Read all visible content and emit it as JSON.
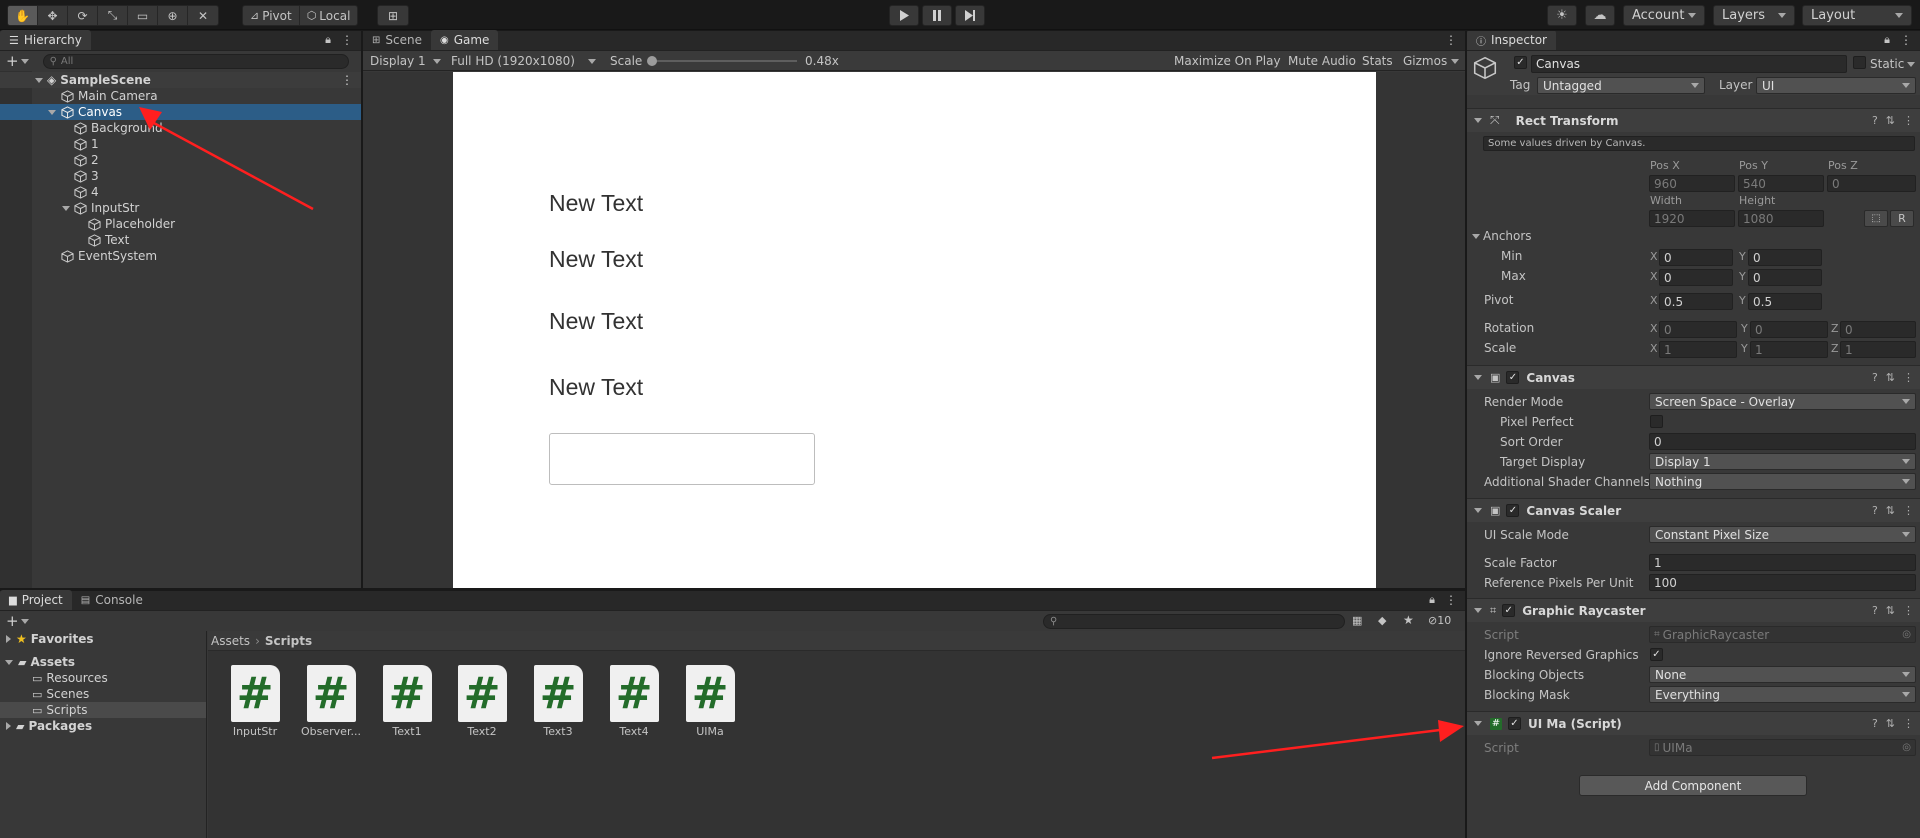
{
  "toolbar": {
    "pivot": "Pivot",
    "local": "Local",
    "account": "Account",
    "layers": "Layers",
    "layout": "Layout"
  },
  "hierarchy": {
    "tab": "Hierarchy",
    "search_placeholder": "All",
    "scene": "SampleScene",
    "items": [
      {
        "label": "Main Camera"
      },
      {
        "label": "Canvas"
      },
      {
        "label": "Background"
      },
      {
        "label": "1"
      },
      {
        "label": "2"
      },
      {
        "label": "3"
      },
      {
        "label": "4"
      },
      {
        "label": "InputStr"
      },
      {
        "label": "Placeholder"
      },
      {
        "label": "Text"
      },
      {
        "label": "EventSystem"
      }
    ]
  },
  "game": {
    "tabs": [
      "Scene",
      "Game"
    ],
    "display": "Display 1",
    "resolution": "Full HD (1920x1080)",
    "scale_label": "Scale",
    "scale_value": "0.48x",
    "scale_fraction": 0.0,
    "maximize": "Maximize On Play",
    "mute": "Mute Audio",
    "stats": "Stats",
    "gizmos": "Gizmos",
    "texts": [
      "New Text",
      "New Text",
      "New Text",
      "New Text"
    ]
  },
  "project": {
    "tabs": [
      "Project",
      "Console"
    ],
    "hidden_count": "10",
    "favorites": "Favorites",
    "assets": "Assets",
    "folders": [
      "Resources",
      "Scenes",
      "Scripts"
    ],
    "packages": "Packages",
    "breadcrumb": [
      "Assets",
      "Scripts"
    ],
    "files": [
      "InputStr",
      "Observer...",
      "Text1",
      "Text2",
      "Text3",
      "Text4",
      "UIMa"
    ]
  },
  "inspector": {
    "tab": "Inspector",
    "object_name": "Canvas",
    "static": "Static",
    "tag_label": "Tag",
    "tag": "Untagged",
    "layer_label": "Layer",
    "layer": "UI",
    "rect_transform": {
      "title": "Rect Transform",
      "note": "Some values driven by Canvas.",
      "pos_x_label": "Pos X",
      "pos_y_label": "Pos Y",
      "pos_z_label": "Pos Z",
      "pos_x": "960",
      "pos_y": "540",
      "pos_z": "0",
      "width_label": "Width",
      "height_label": "Height",
      "width": "1920",
      "height": "1080",
      "r_button": "R",
      "anchors": "Anchors",
      "min": "Min",
      "max": "Max",
      "min_x": "0",
      "min_y": "0",
      "max_x": "0",
      "max_y": "0",
      "pivot": "Pivot",
      "pivot_x": "0.5",
      "pivot_y": "0.5",
      "rotation": "Rotation",
      "rot_x": "0",
      "rot_y": "0",
      "rot_z": "0",
      "scale": "Scale",
      "scale_x": "1",
      "scale_y": "1",
      "scale_z": "1",
      "x": "X",
      "y": "Y",
      "z": "Z"
    },
    "canvas": {
      "title": "Canvas",
      "render_mode_label": "Render Mode",
      "render_mode": "Screen Space - Overlay",
      "pixel_perfect_label": "Pixel Perfect",
      "sort_order_label": "Sort Order",
      "sort_order": "0",
      "target_display_label": "Target Display",
      "target_display": "Display 1",
      "shader_channels_label": "Additional Shader Channels",
      "shader_channels": "Nothing"
    },
    "canvas_scaler": {
      "title": "Canvas Scaler",
      "scale_mode_label": "UI Scale Mode",
      "scale_mode": "Constant Pixel Size",
      "scale_factor_label": "Scale Factor",
      "scale_factor": "1",
      "ref_ppu_label": "Reference Pixels Per Unit",
      "ref_ppu": "100"
    },
    "graphic_raycaster": {
      "title": "Graphic Raycaster",
      "script_label": "Script",
      "script": "GraphicRaycaster",
      "ignore_reversed_label": "Ignore Reversed Graphics",
      "blocking_objects_label": "Blocking Objects",
      "blocking_objects": "None",
      "blocking_mask_label": "Blocking Mask",
      "blocking_mask": "Everything"
    },
    "ui_ma": {
      "title": "UI Ma (Script)",
      "script_label": "Script",
      "script": "UIMa"
    },
    "add_component": "Add Component"
  }
}
